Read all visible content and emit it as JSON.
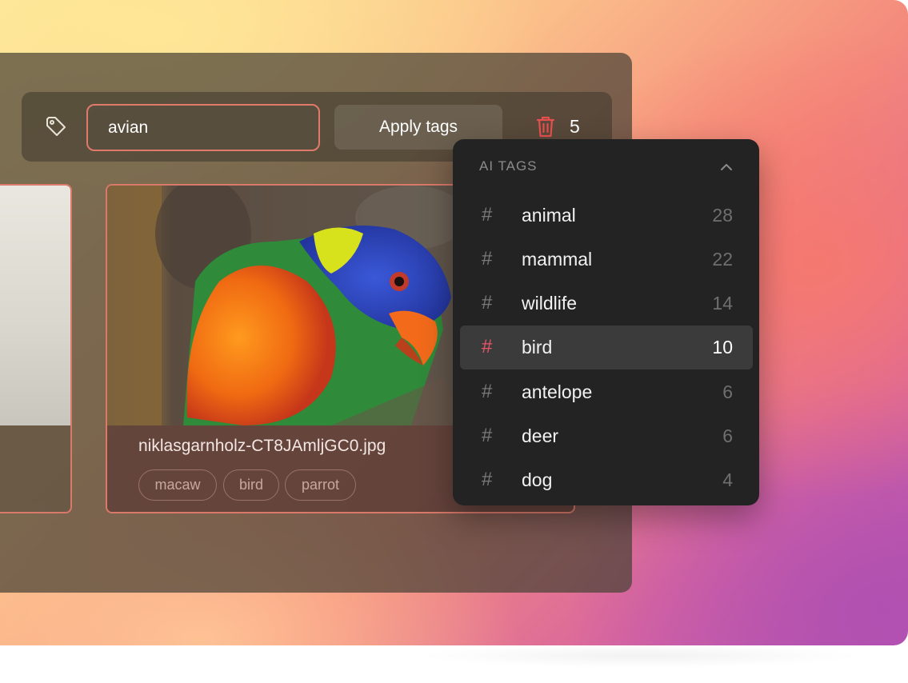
{
  "toolbar": {
    "search_value": "avian",
    "apply_label": "Apply tags",
    "selected_count": "5"
  },
  "card": {
    "filename": "niklasgarnholz-CT8JAmljGC0.jpg",
    "tags": [
      "macaw",
      "bird",
      "parrot"
    ]
  },
  "dropdown": {
    "title": "AI TAGS",
    "items": [
      {
        "hash": "#",
        "label": "animal",
        "count": "28"
      },
      {
        "hash": "#",
        "label": "mammal",
        "count": "22"
      },
      {
        "hash": "#",
        "label": "wildlife",
        "count": "14"
      },
      {
        "hash": "#",
        "label": "bird",
        "count": "10",
        "selected": true
      },
      {
        "hash": "#",
        "label": "antelope",
        "count": "6"
      },
      {
        "hash": "#",
        "label": "deer",
        "count": "6"
      },
      {
        "hash": "#",
        "label": "dog",
        "count": "4"
      }
    ]
  },
  "colors": {
    "accent": "#e9566a",
    "selection_border": "#d9796a",
    "dropdown_bg": "#232323"
  },
  "icons": {
    "tag": "tag-icon",
    "trash": "trash-icon",
    "collapse": "chevron-up-icon"
  }
}
